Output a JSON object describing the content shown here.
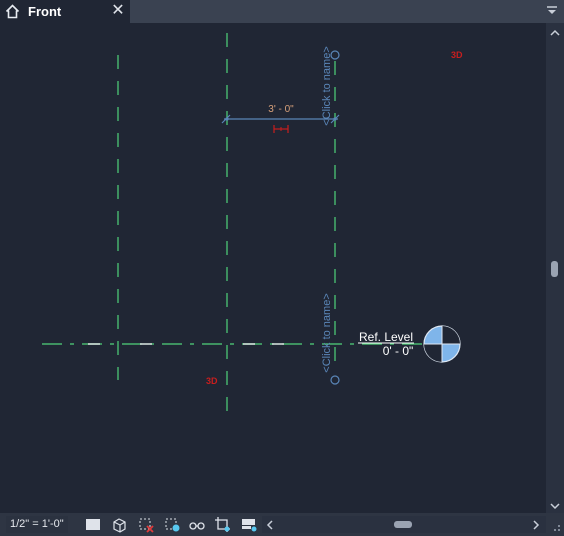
{
  "tab": {
    "title": "Front",
    "close_glyph": "✕",
    "icons": {
      "home": "home-icon",
      "close": "close-icon",
      "dropdown": "tab-dropdown-icon"
    }
  },
  "canvas": {
    "dimension_text": "3' - 0\"",
    "grid_label_top": "<Click to name>",
    "grid_label_bottom": "<Click to name>",
    "level_name": "Ref. Level",
    "level_elevation": "0' - 0\"",
    "tag_3d_top": "3D",
    "tag_3d_bottom": "3D",
    "colors": {
      "grid_line": "#4fd37a",
      "grid_label": "#5a86b8",
      "dimension_text": "#d7a07a",
      "tag_3d": "#c81e1e",
      "level_head_fill": "#7fb5ea",
      "level_text": "#ffffff"
    }
  },
  "bottom_bar": {
    "scale": "1/2\" = 1'-0\"",
    "icons": [
      "detail-level-icon",
      "visual-style-icon",
      "reveal-hidden-icon",
      "temporary-hide-isolate-icon",
      "show-analytical-model-icon",
      "crop-view-icon",
      "view-properties-icon"
    ]
  },
  "scrollbars": {
    "vertical": [
      "scroll-up-icon",
      "scroll-down-icon"
    ],
    "horizontal": [
      "scroll-left-icon",
      "scroll-right-icon"
    ]
  }
}
